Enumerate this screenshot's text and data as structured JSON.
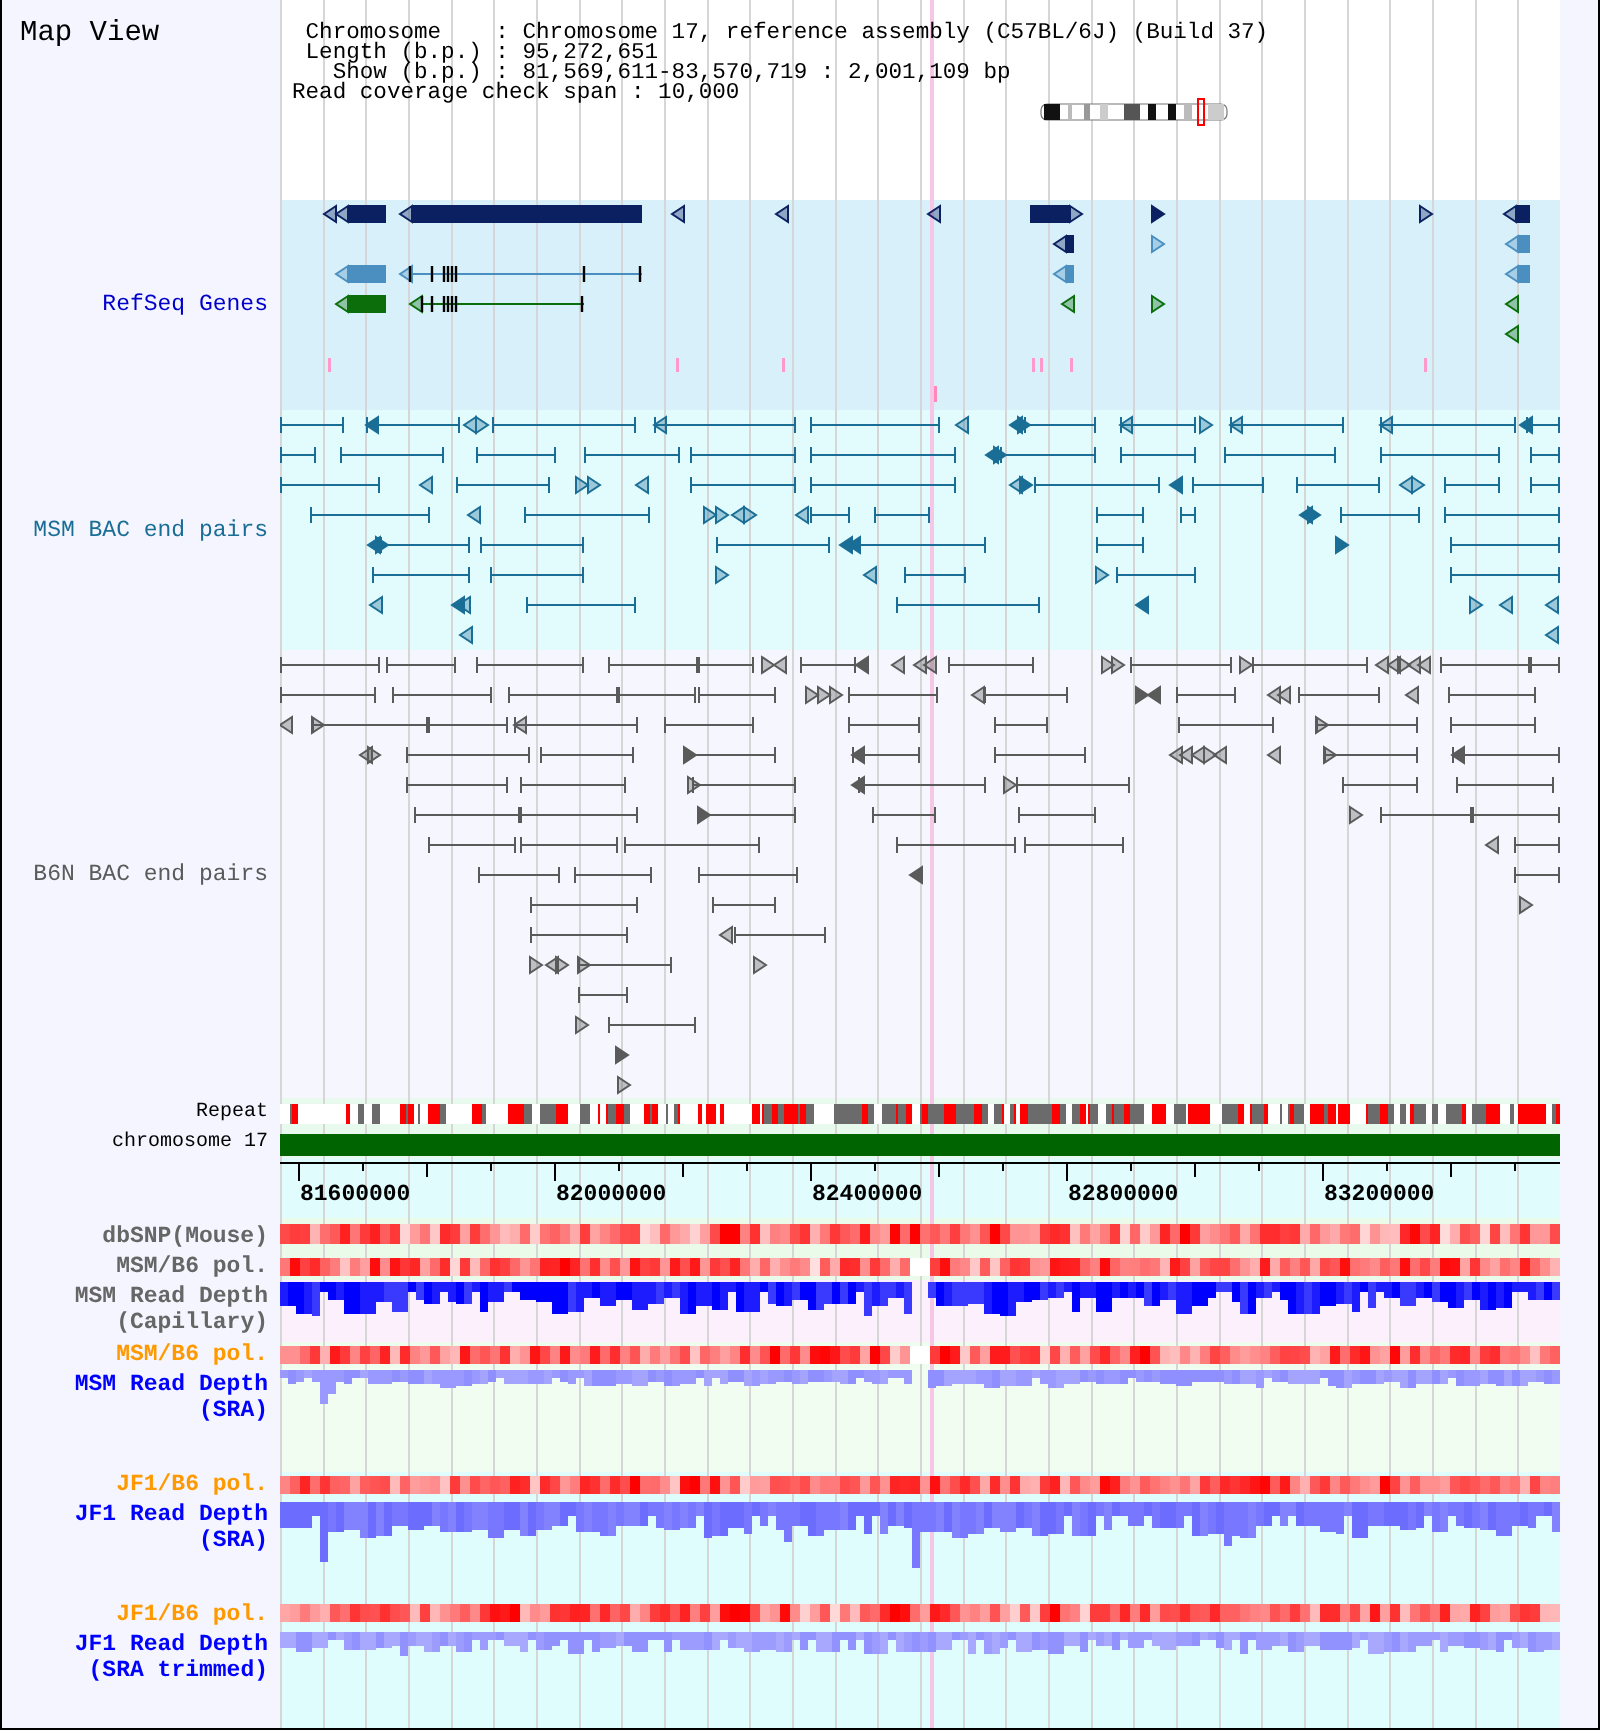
{
  "title": "Map View",
  "info_lines": [
    "Chromosome    : Chromosome 17, reference assembly (C57BL/6J) (Build 37)",
    "Length (b.p.) : 95,272,651",
    "Show (b.p.) : 81,569,611-83,570,719 : 2,001,109 bp",
    "Read coverage check span : 10,000"
  ],
  "tracks": [
    {
      "kind": "genes",
      "label": "RefSeq Genes",
      "color": "#0000cc"
    },
    {
      "kind": "bac_pairs",
      "label": "MSM BAC end pairs",
      "color": "#1a6e96"
    },
    {
      "kind": "bac_pairs",
      "label": "B6N BAC end pairs",
      "color": "#5a5a5a"
    },
    {
      "kind": "repeat",
      "label": "Repeat",
      "color": "#000000"
    },
    {
      "kind": "chromosome",
      "label": "chromosome 17",
      "color": "#000000"
    },
    {
      "kind": "axis",
      "ticks": [
        "81600000",
        "82000000",
        "82400000",
        "82800000",
        "83200000"
      ]
    },
    {
      "kind": "snp",
      "label": "dbSNP(Mouse)",
      "color": "#666666"
    },
    {
      "kind": "polymorphism",
      "label": "MSM/B6 pol.",
      "color": "#666666"
    },
    {
      "kind": "depth",
      "label": "MSM Read Depth (Capillary)",
      "color": "#666666"
    },
    {
      "kind": "polymorphism",
      "label": "MSM/B6 pol.",
      "color": "#ff9900"
    },
    {
      "kind": "depth",
      "label": "MSM Read Depth (SRA)",
      "color": "#0000ff"
    },
    {
      "kind": "polymorphism",
      "label": "JF1/B6 pol.",
      "color": "#ff9900"
    },
    {
      "kind": "depth",
      "label": "JF1 Read Depth (SRA)",
      "color": "#0000ff"
    },
    {
      "kind": "polymorphism",
      "label": "JF1/B6 pol.",
      "color": "#ff9900"
    },
    {
      "kind": "depth",
      "label": "JF1 Read Depth (SRA trimmed)",
      "color": "#0000ff"
    }
  ]
}
